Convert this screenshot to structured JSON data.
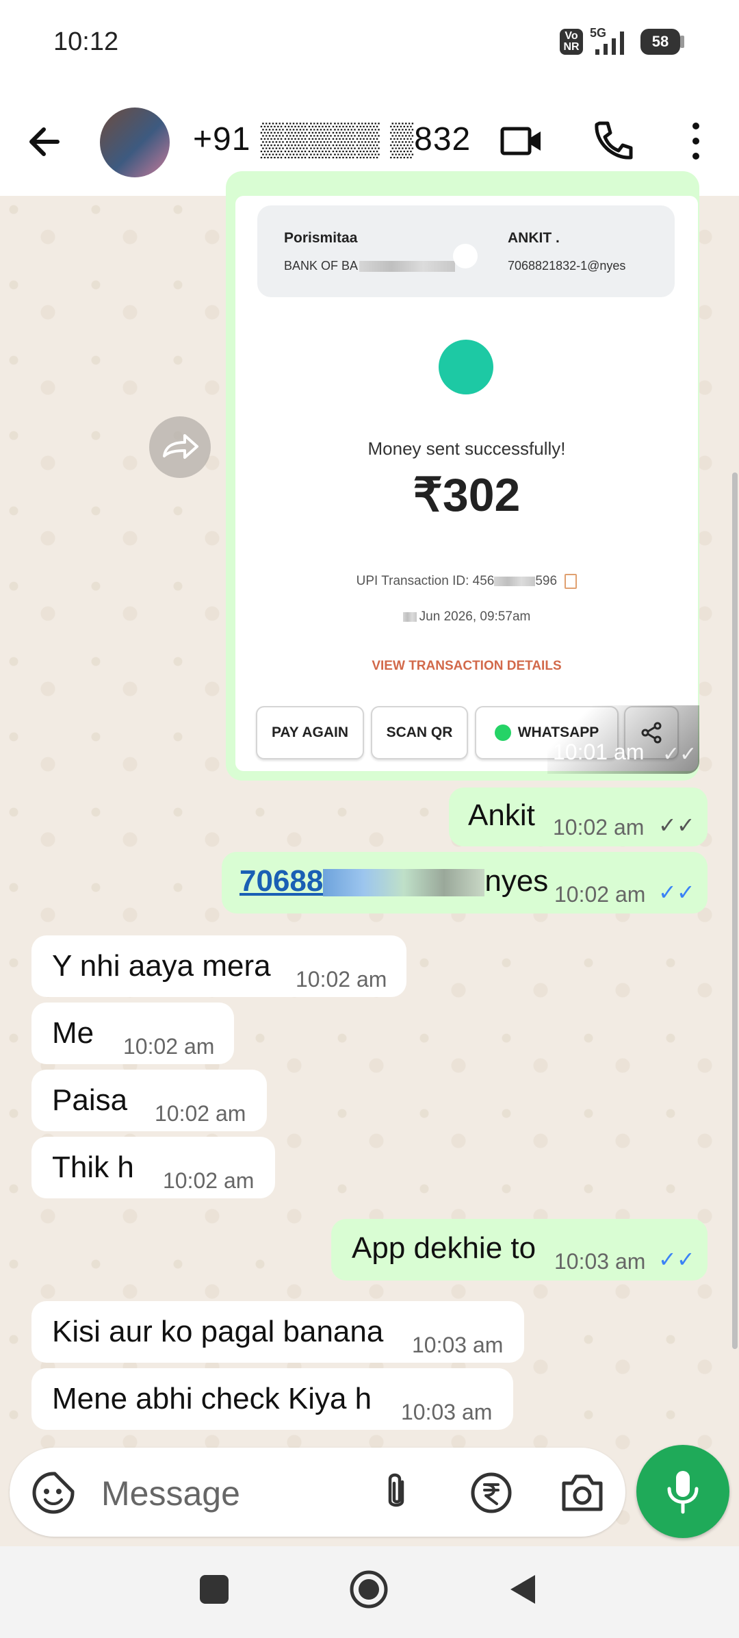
{
  "status_bar": {
    "time": "10:12",
    "volte": "Vo NR",
    "network": "5G",
    "battery": "58"
  },
  "header": {
    "contact": "+91 ▒▒▒▒▒ ▒832"
  },
  "payment_card": {
    "sender_name": "Porismitaa",
    "sender_bank": "BANK OF BA",
    "receiver_name": "ANKIT .",
    "receiver_upi": "7068821832-1@nyes",
    "status_text": "Money sent successfully!",
    "amount": "₹302",
    "txn_label": "UPI Transaction ID: 456",
    "txn_suffix": "596",
    "date_text": "Jun 2026, 09:57am",
    "view_details": "VIEW TRANSACTION DETAILS",
    "buttons": [
      "PAY AGAIN",
      "SCAN QR",
      "WHATSAPP"
    ],
    "time": "10:01 am"
  },
  "messages": [
    {
      "dir": "out",
      "text": "Ankit",
      "time": "10:02 am"
    },
    {
      "dir": "out",
      "text": "70688",
      "text_tail": "nyes",
      "time": "10:02 am"
    },
    {
      "dir": "in",
      "text": "Y nhi aaya mera",
      "time": "10:02 am"
    },
    {
      "dir": "in",
      "text": "Me",
      "time": "10:02 am"
    },
    {
      "dir": "in",
      "text": "Paisa",
      "time": "10:02 am"
    },
    {
      "dir": "in",
      "text": "Thik h",
      "time": "10:02 am"
    },
    {
      "dir": "out",
      "text": "App dekhie to",
      "time": "10:03 am"
    },
    {
      "dir": "in",
      "text": "Kisi aur ko pagal banana",
      "time": "10:03 am"
    },
    {
      "dir": "in",
      "text": "Mene abhi check Kiya h",
      "time": "10:03 am"
    }
  ],
  "input": {
    "placeholder": "Message"
  },
  "colors": {
    "accent": "#1faa59",
    "out_bubble": "#d9fdd3",
    "read_ticks": "#3b82f6",
    "link": "#1a5fb4"
  },
  "icons": [
    "back-arrow-icon",
    "video-call-icon",
    "phone-icon",
    "more-vert-icon",
    "forward-icon",
    "sticker-icon",
    "attach-icon",
    "rupee-icon",
    "camera-icon",
    "mic-icon",
    "copy-icon",
    "share-icon",
    "whatsapp-icon"
  ]
}
